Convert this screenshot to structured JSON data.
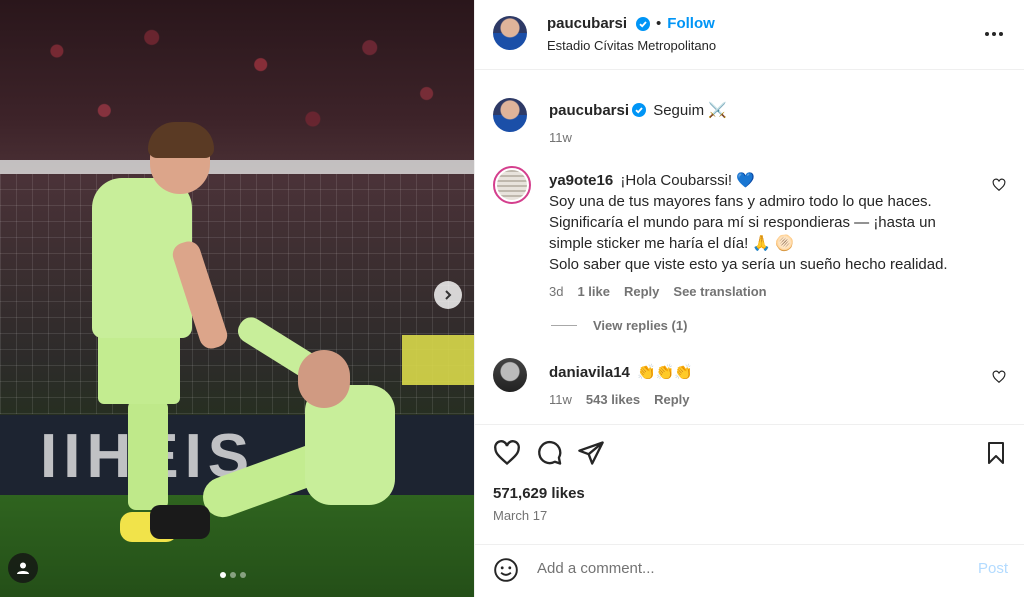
{
  "post": {
    "author": "paucubarsi",
    "follow_label": "Follow",
    "separator": "•",
    "location": "Estadio Cívitas Metropolitano",
    "caption_text": "Seguim ⚔️",
    "caption_time": "11w",
    "likes": "571,629 likes",
    "date": "March 17",
    "image_dots": 3,
    "active_dot": 0
  },
  "comments": [
    {
      "user": "ya9ote16",
      "lines": [
        "¡Hola Coubarssi! 💙",
        "Soy una de tus mayores fans y admiro todo lo que haces.",
        "Significaría el mundo para mí si respondieras — ¡hasta un",
        "simple sticker me haría el día! 🙏 🫓",
        "Solo saber que viste esto ya sería un sueño hecho realidad."
      ],
      "time": "3d",
      "likes": "1 like",
      "reply": "Reply",
      "translate": "See translation",
      "view_replies": "View replies (1)"
    },
    {
      "user": "daniavila14",
      "text": "👏👏👏",
      "time": "11w",
      "likes": "543 likes",
      "reply": "Reply"
    }
  ],
  "add_comment": {
    "placeholder": "Add a comment...",
    "post_label": "Post"
  },
  "photo": {
    "ad_text": "IIHEIS"
  },
  "colors": {
    "accent": "#0095f6",
    "post_disabled": "#b3dbff",
    "muted": "#737373"
  }
}
